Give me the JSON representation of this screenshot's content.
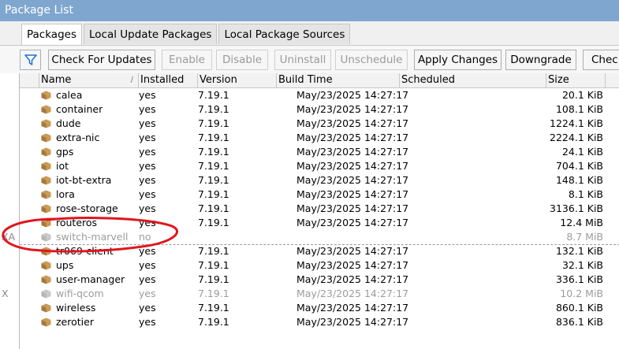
{
  "window": {
    "title": "Package List"
  },
  "tabs": [
    "Packages",
    "Local Update Packages",
    "Local Package Sources"
  ],
  "toolbar": {
    "check_for_updates": "Check For Updates",
    "enable": "Enable",
    "disable": "Disable",
    "uninstall": "Uninstall",
    "unschedule": "Unschedule",
    "apply_changes": "Apply Changes",
    "downgrade": "Downgrade",
    "check_installation": "Check"
  },
  "columns": {
    "name": "Name",
    "installed": "Installed",
    "version": "Version",
    "build_time": "Build Time",
    "scheduled": "Scheduled",
    "size": "Size",
    "sort_indicator": "/"
  },
  "packages": [
    {
      "flags": "",
      "name": "calea",
      "installed": "yes",
      "version": "7.19.1",
      "build_time": "May/23/2025 14:27:17",
      "size": "20.1 KiB"
    },
    {
      "flags": "",
      "name": "container",
      "installed": "yes",
      "version": "7.19.1",
      "build_time": "May/23/2025 14:27:17",
      "size": "108.1 KiB"
    },
    {
      "flags": "",
      "name": "dude",
      "installed": "yes",
      "version": "7.19.1",
      "build_time": "May/23/2025 14:27:17",
      "size": "1224.1 KiB"
    },
    {
      "flags": "",
      "name": "extra-nic",
      "installed": "yes",
      "version": "7.19.1",
      "build_time": "May/23/2025 14:27:17",
      "size": "2224.1 KiB"
    },
    {
      "flags": "",
      "name": "gps",
      "installed": "yes",
      "version": "7.19.1",
      "build_time": "May/23/2025 14:27:17",
      "size": "24.1 KiB"
    },
    {
      "flags": "",
      "name": "iot",
      "installed": "yes",
      "version": "7.19.1",
      "build_time": "May/23/2025 14:27:17",
      "size": "704.1 KiB"
    },
    {
      "flags": "",
      "name": "iot-bt-extra",
      "installed": "yes",
      "version": "7.19.1",
      "build_time": "May/23/2025 14:27:17",
      "size": "148.1 KiB"
    },
    {
      "flags": "",
      "name": "lora",
      "installed": "yes",
      "version": "7.19.1",
      "build_time": "May/23/2025 14:27:17",
      "size": "8.1 KiB"
    },
    {
      "flags": "",
      "name": "rose-storage",
      "installed": "yes",
      "version": "7.19.1",
      "build_time": "May/23/2025 14:27:17",
      "size": "3136.1 KiB"
    },
    {
      "flags": "",
      "name": "routeros",
      "installed": "yes",
      "version": "7.19.1",
      "build_time": "May/23/2025 14:27:17",
      "size": "12.4 MiB"
    },
    {
      "flags": "XA",
      "name": "switch-marvell",
      "installed": "no",
      "version": "",
      "build_time": "",
      "size": "8.7 MiB"
    },
    {
      "flags": "",
      "name": "tr069-client",
      "installed": "yes",
      "version": "7.19.1",
      "build_time": "May/23/2025 14:27:17",
      "size": "132.1 KiB"
    },
    {
      "flags": "",
      "name": "ups",
      "installed": "yes",
      "version": "7.19.1",
      "build_time": "May/23/2025 14:27:17",
      "size": "32.1 KiB"
    },
    {
      "flags": "",
      "name": "user-manager",
      "installed": "yes",
      "version": "7.19.1",
      "build_time": "May/23/2025 14:27:17",
      "size": "336.1 KiB"
    },
    {
      "flags": "X",
      "name": "wifi-qcom",
      "installed": "yes",
      "version": "7.19.1",
      "build_time": "May/23/2025 14:27:17",
      "size": "10.2 MiB"
    },
    {
      "flags": "",
      "name": "wireless",
      "installed": "yes",
      "version": "7.19.1",
      "build_time": "May/23/2025 14:27:17",
      "size": "860.1 KiB"
    },
    {
      "flags": "",
      "name": "zerotier",
      "installed": "yes",
      "version": "7.19.1",
      "build_time": "May/23/2025 14:27:17",
      "size": "836.1 KiB"
    }
  ],
  "colors": {
    "titlebar": "#7fa6cf",
    "annotation": "#e0161d",
    "package_icon": "#c89a55"
  }
}
